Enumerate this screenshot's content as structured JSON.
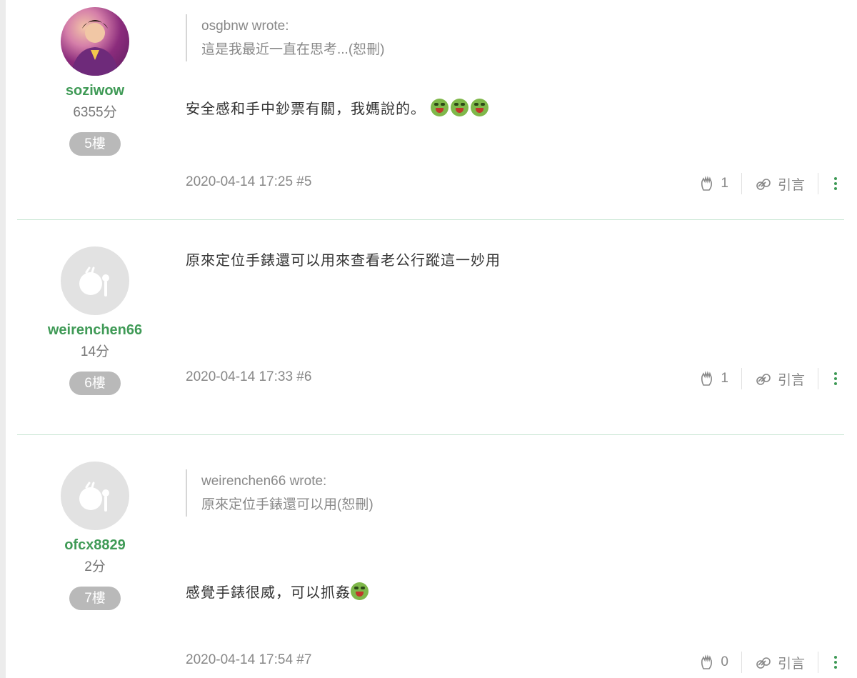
{
  "posts": [
    {
      "author": {
        "name": "soziwow",
        "score": "6355分",
        "floor": "5樓",
        "avatar": "photo"
      },
      "quote": {
        "header": "osgbnw wrote:",
        "text": "這是我最近一直在思考...(恕刪)"
      },
      "text": "安全感和手中鈔票有關，我媽說的。",
      "emojis": [
        "grin-icon",
        "grin-icon",
        "grin-icon"
      ],
      "meta": "2020-04-14 17:25 #5",
      "likes": "1",
      "quote_label": "引言"
    },
    {
      "author": {
        "name": "weirenchen66",
        "score": "14分",
        "floor": "6樓",
        "avatar": "default"
      },
      "text": "原來定位手錶還可以用來查看老公行蹤這一妙用",
      "meta": "2020-04-14 17:33 #6",
      "likes": "1",
      "quote_label": "引言"
    },
    {
      "author": {
        "name": "ofcx8829",
        "score": "2分",
        "floor": "7樓",
        "avatar": "default"
      },
      "quote": {
        "header": "weirenchen66 wrote:",
        "text": "原來定位手錶還可以用(恕刪)"
      },
      "text": "感覺手錶很威，可以抓姦",
      "emojis": [
        "dizzy-face-icon"
      ],
      "meta": "2020-04-14 17:54 #7",
      "likes": "0",
      "quote_label": "引言"
    }
  ],
  "colors": {
    "username": "#3f9a56",
    "badge": "#b9b9b9",
    "divider": "#c9e6d4",
    "emoji": "#7fb84a"
  }
}
